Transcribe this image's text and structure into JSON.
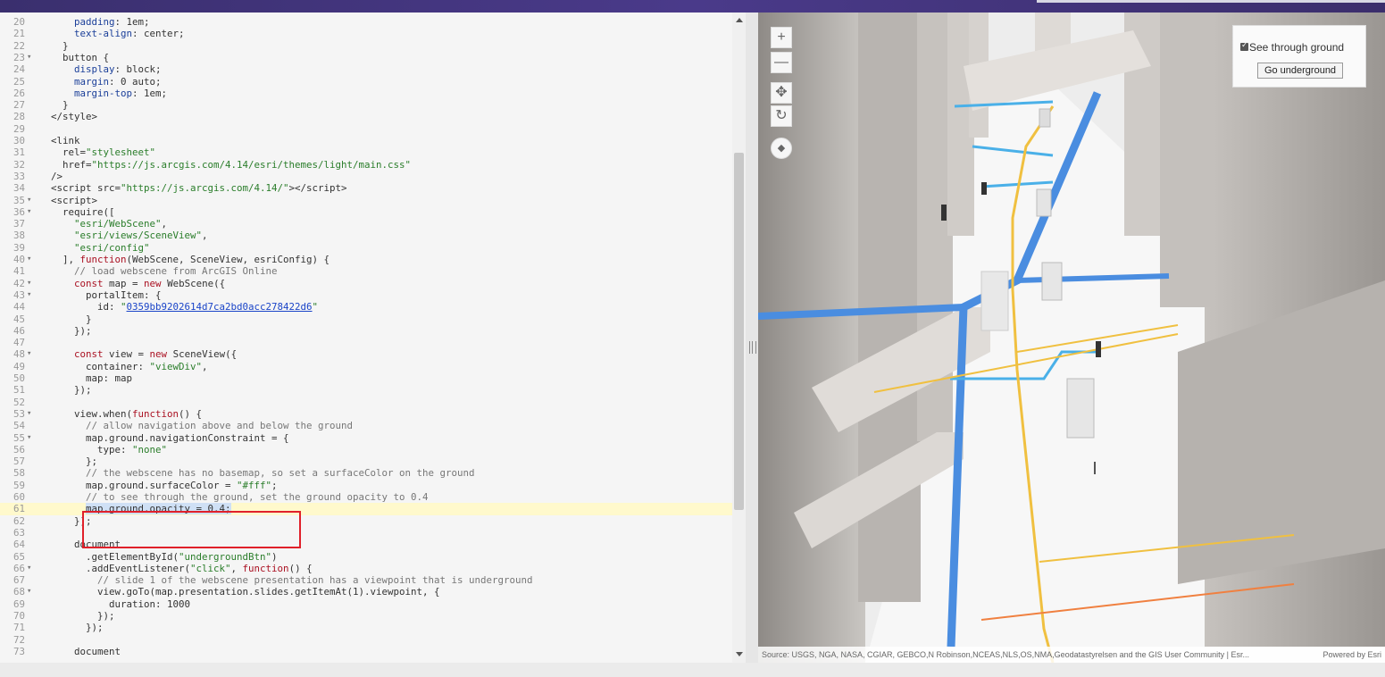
{
  "editor": {
    "lines": [
      {
        "n": "20",
        "fold": "",
        "html": "    <span class=\"t\">padding</span>: 1em;"
      },
      {
        "n": "21",
        "fold": "",
        "html": "    <span class=\"t\">text-align</span>: center;"
      },
      {
        "n": "22",
        "fold": "",
        "html": "  }"
      },
      {
        "n": "23",
        "fold": "▾",
        "html": "  button {"
      },
      {
        "n": "24",
        "fold": "",
        "html": "    <span class=\"t\">display</span>: block;"
      },
      {
        "n": "25",
        "fold": "",
        "html": "    <span class=\"t\">margin</span>: 0 auto;"
      },
      {
        "n": "26",
        "fold": "",
        "html": "    <span class=\"t\">margin-top</span>: 1em;"
      },
      {
        "n": "27",
        "fold": "",
        "html": "  }"
      },
      {
        "n": "28",
        "fold": "",
        "html": "&lt;/style&gt;"
      },
      {
        "n": "29",
        "fold": "",
        "html": ""
      },
      {
        "n": "30",
        "fold": "",
        "html": "&lt;link"
      },
      {
        "n": "31",
        "fold": "",
        "html": "  rel=<span class=\"s\">\"stylesheet\"</span>"
      },
      {
        "n": "32",
        "fold": "",
        "html": "  href=<span class=\"s\">\"https://js.arcgis.com/4.14/esri/themes/light/main.css\"</span>"
      },
      {
        "n": "33",
        "fold": "",
        "html": "/&gt;"
      },
      {
        "n": "34",
        "fold": "",
        "html": "&lt;script src=<span class=\"s\">\"https://js.arcgis.com/4.14/\"</span>&gt;&lt;/script&gt;"
      },
      {
        "n": "35",
        "fold": "▾",
        "html": "&lt;script&gt;"
      },
      {
        "n": "36",
        "fold": "▾",
        "html": "  require(["
      },
      {
        "n": "37",
        "fold": "",
        "html": "    <span class=\"s\">\"esri/WebScene\"</span>,"
      },
      {
        "n": "38",
        "fold": "",
        "html": "    <span class=\"s\">\"esri/views/SceneView\"</span>,"
      },
      {
        "n": "39",
        "fold": "",
        "html": "    <span class=\"s\">\"esri/config\"</span>"
      },
      {
        "n": "40",
        "fold": "▾",
        "html": "  ], <span class=\"k\">function</span>(WebScene, SceneView, esriConfig) {"
      },
      {
        "n": "41",
        "fold": "",
        "html": "    <span class=\"c\">// load webscene from ArcGIS Online</span>"
      },
      {
        "n": "42",
        "fold": "▾",
        "html": "    <span class=\"k\">const</span> map = <span class=\"k\">new</span> WebScene({"
      },
      {
        "n": "43",
        "fold": "▾",
        "html": "      portalItem: {"
      },
      {
        "n": "44",
        "fold": "",
        "html": "        id: <span class=\"s\">\"<span class=\"u\">0359bb9202614d7ca2bd0acc278422d6</span>\"</span>"
      },
      {
        "n": "45",
        "fold": "",
        "html": "      }"
      },
      {
        "n": "46",
        "fold": "",
        "html": "    });"
      },
      {
        "n": "47",
        "fold": "",
        "html": ""
      },
      {
        "n": "48",
        "fold": "▾",
        "html": "    <span class=\"k\">const</span> view = <span class=\"k\">new</span> SceneView({"
      },
      {
        "n": "49",
        "fold": "",
        "html": "      container: <span class=\"s\">\"viewDiv\"</span>,"
      },
      {
        "n": "50",
        "fold": "",
        "html": "      map: map"
      },
      {
        "n": "51",
        "fold": "",
        "html": "    });"
      },
      {
        "n": "52",
        "fold": "",
        "html": ""
      },
      {
        "n": "53",
        "fold": "▾",
        "html": "    view.when(<span class=\"k\">function</span>() {"
      },
      {
        "n": "54",
        "fold": "",
        "html": "      <span class=\"c\">// allow navigation above and below the ground</span>"
      },
      {
        "n": "55",
        "fold": "▾",
        "html": "      map.ground.navigationConstraint = {"
      },
      {
        "n": "56",
        "fold": "",
        "html": "        type: <span class=\"s\">\"none\"</span>"
      },
      {
        "n": "57",
        "fold": "",
        "html": "      };"
      },
      {
        "n": "58",
        "fold": "",
        "html": "      <span class=\"c\">// the webscene has no basemap, so set a surfaceColor on the ground</span>"
      },
      {
        "n": "59",
        "fold": "",
        "html": "      map.ground.surfaceColor = <span class=\"s\">\"#fff\"</span>;"
      },
      {
        "n": "60",
        "fold": "",
        "html": "      <span class=\"c\">// to see through the ground, set the ground opacity to 0.4</span>"
      },
      {
        "n": "61",
        "fold": "",
        "html": "      <span class=\"sel\">map.ground.opacity = 0.4;</span>"
      },
      {
        "n": "62",
        "fold": "",
        "html": "    });"
      },
      {
        "n": "63",
        "fold": "",
        "html": ""
      },
      {
        "n": "64",
        "fold": "",
        "html": "    document"
      },
      {
        "n": "65",
        "fold": "",
        "html": "      .getElementById(<span class=\"s\">\"undergroundBtn\"</span>)"
      },
      {
        "n": "66",
        "fold": "▾",
        "html": "      .addEventListener(<span class=\"s\">\"click\"</span>, <span class=\"k\">function</span>() {"
      },
      {
        "n": "67",
        "fold": "",
        "html": "        <span class=\"c\">// slide 1 of the webscene presentation has a viewpoint that is underground</span>"
      },
      {
        "n": "68",
        "fold": "▾",
        "html": "        view.goTo(map.presentation.slides.getItemAt(1).viewpoint, {"
      },
      {
        "n": "69",
        "fold": "",
        "html": "          duration: 1000"
      },
      {
        "n": "70",
        "fold": "",
        "html": "        });"
      },
      {
        "n": "71",
        "fold": "",
        "html": "      });"
      },
      {
        "n": "72",
        "fold": "",
        "html": ""
      },
      {
        "n": "73",
        "fold": "",
        "html": "    document"
      }
    ],
    "active_line": "61"
  },
  "scene": {
    "zoom_in": "+",
    "zoom_out": "—",
    "pan_icon": "✥",
    "rotate_icon": "↻",
    "compass_icon": "◆",
    "panel": {
      "checkbox_label": "See through ground",
      "checked": true,
      "button_label": "Go underground"
    },
    "attribution": "Source: USGS, NGA, NASA, CGIAR, GEBCO,N Robinson,NCEAS,NLS,OS,NMA,Geodatastyrelsen and the GIS User Community | Esr...",
    "powered_by": "Powered by Esri"
  }
}
